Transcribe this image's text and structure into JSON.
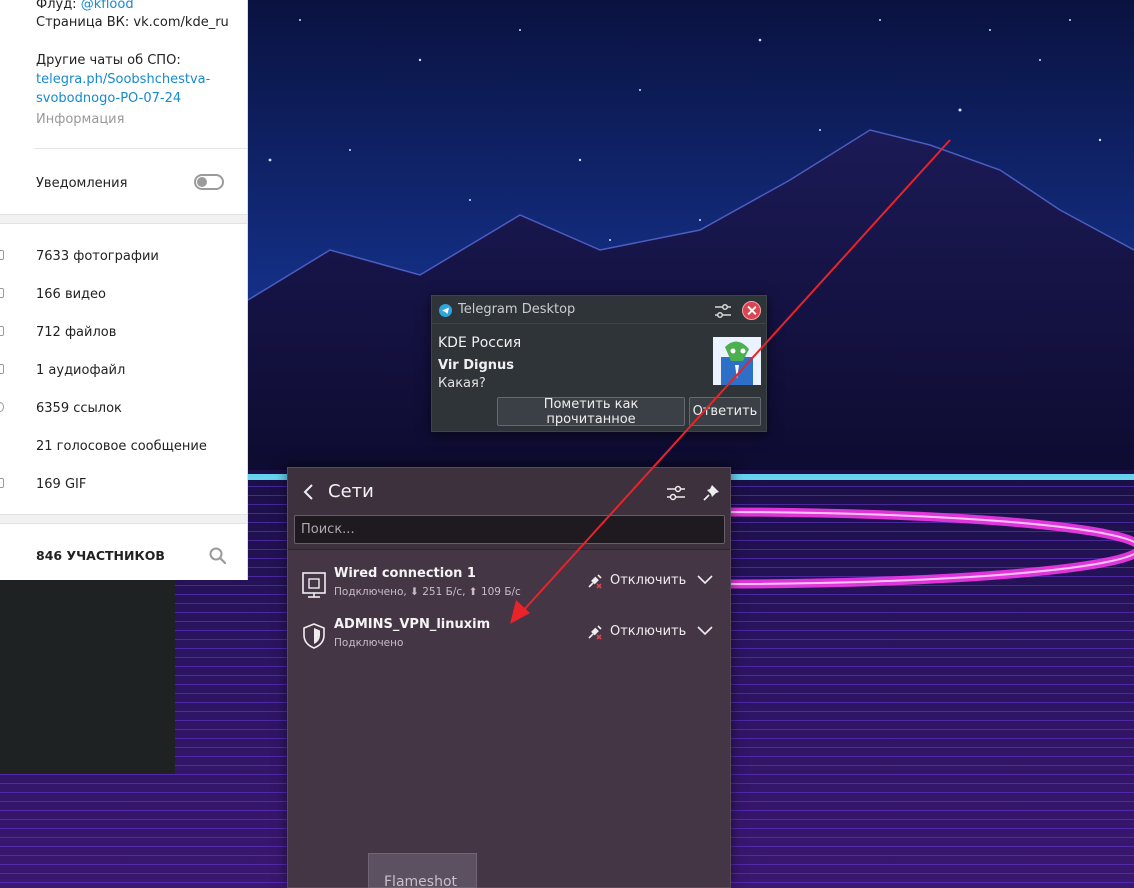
{
  "telegram_info": {
    "flood_prefix": "Флуд: ",
    "flood_handle": "@kflood",
    "vk_page": "Страница ВК: vk.com/kde_ru",
    "other_chats": "Другие чаты об СПО:",
    "link_line1": "telegra.ph/Soobshchestva-",
    "link_line2": "svobodnogo-PO-07-24",
    "info_label": "Информация",
    "notifications_label": "Уведомления",
    "media": [
      {
        "label": "7633 фотографии"
      },
      {
        "label": "166 видео"
      },
      {
        "label": "712 файлов"
      },
      {
        "label": "1 аудиофайл"
      },
      {
        "label": "6359 ссылок"
      },
      {
        "label": "21 голосовое сообщение"
      },
      {
        "label": "169 GIF"
      }
    ],
    "members": "846 УЧАСТНИКОВ"
  },
  "notification": {
    "app_name": "Telegram Desktop",
    "title": "KDE Россия",
    "sender": "Vir Dignus",
    "body": "Какая?",
    "mark_read": "Пометить как прочитанное",
    "reply": "Ответить"
  },
  "networks": {
    "title": "Сети",
    "search_placeholder": "Поиск...",
    "connections": [
      {
        "name": "Wired connection 1",
        "status": "Подключено, ⬇ 251 Б/с, ⬆ 109 Б/с",
        "action": "Отключить",
        "icon": "wired-icon"
      },
      {
        "name": "ADMINS_VPN_linuxim",
        "status": "Подключено",
        "action": "Отключить",
        "icon": "vpn-shield-icon"
      }
    ]
  },
  "flameshot": {
    "label": "Flameshot"
  },
  "colors": {
    "arrow": "#e8232a",
    "link": "#168acd",
    "close": "#da4453"
  }
}
